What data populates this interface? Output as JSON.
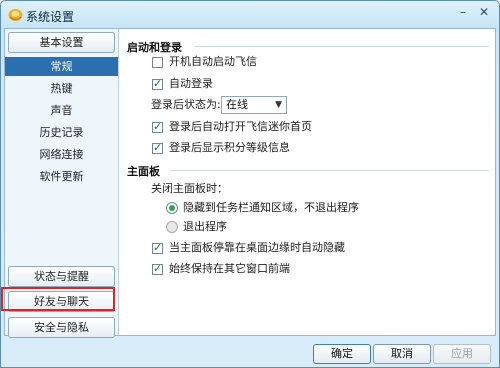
{
  "window": {
    "title": "系统设置"
  },
  "sidebar": {
    "top_button": "基本设置",
    "items": [
      {
        "label": "常规",
        "active": true
      },
      {
        "label": "热键"
      },
      {
        "label": "声音"
      },
      {
        "label": "历史记录"
      },
      {
        "label": "网络连接"
      },
      {
        "label": "软件更新"
      }
    ],
    "bottom_buttons": [
      "状态与提醒",
      "好友与聊天",
      "安全与隐私"
    ]
  },
  "main": {
    "section1": {
      "title": "启动和登录",
      "autostart": {
        "label": "开机自动启动飞信",
        "checked": false
      },
      "autologin": {
        "label": "自动登录",
        "checked": true
      },
      "status_label": "登录后状态为:",
      "status_value": "在线",
      "open_home": {
        "label": "登录后自动打开飞信迷你首页",
        "checked": true
      },
      "show_points": {
        "label": "登录后显示积分等级信息",
        "checked": true
      }
    },
    "section2": {
      "title": "主面板",
      "close_label": "关闭主面板时：",
      "hide_option": {
        "label": "隐藏到任务栏通知区域，不退出程序",
        "selected": true
      },
      "exit_option": {
        "label": "退出程序",
        "selected": false
      },
      "auto_hide": {
        "label": "当主面板停靠在桌面边缘时自动隐藏",
        "checked": true
      },
      "always_top": {
        "label": "始终保持在其它窗口前端",
        "checked": true
      }
    }
  },
  "footer": {
    "ok": "确定",
    "cancel": "取消",
    "apply": "应用"
  }
}
